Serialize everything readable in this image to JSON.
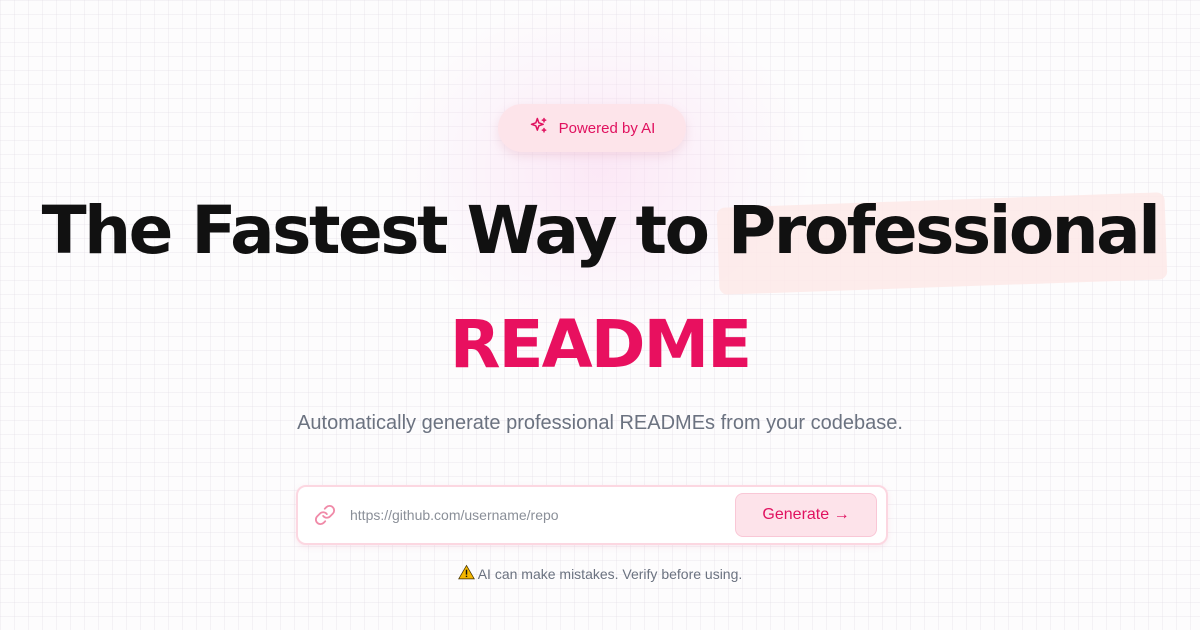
{
  "badge": {
    "icon": "sparkles-icon",
    "label": "Powered by AI"
  },
  "headline": {
    "lead": "The Fastest Way to",
    "highlight": "Professional",
    "accent": "README"
  },
  "subtitle": "Automatically generate professional READMEs from your codebase.",
  "form": {
    "link_icon": "link-icon",
    "url_placeholder": "https://github.com/username/repo",
    "url_value": "",
    "generate_label": "Generate →"
  },
  "disclaimer": {
    "icon": "warning-icon",
    "text": "AI can make mistakes. Verify before using."
  },
  "colors": {
    "accent": "#e8105f",
    "badge_bg": "#fde4ea",
    "highlight_bg": "#fde9e7",
    "text": "#111111",
    "muted": "#6b7280"
  }
}
